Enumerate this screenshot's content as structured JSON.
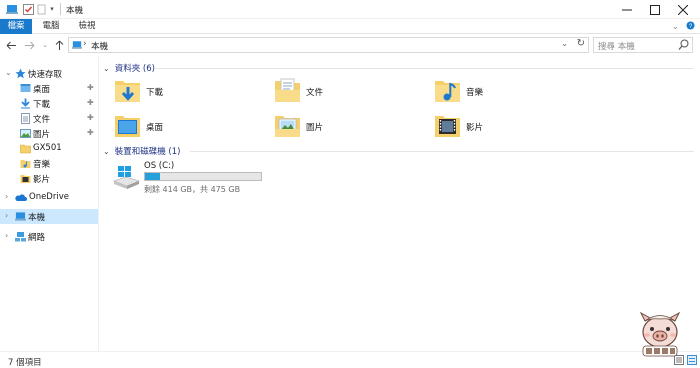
{
  "window": {
    "title": "本機",
    "controls": [
      "minimize-icon",
      "maximize-icon",
      "close-icon"
    ]
  },
  "ribbon": {
    "tabs": [
      {
        "label": "檔案"
      },
      {
        "label": "電腦"
      },
      {
        "label": "檢視"
      }
    ]
  },
  "address": {
    "path": "本機",
    "search_placeholder": "搜尋 本機"
  },
  "nav_pane": {
    "quick_access": "快速存取",
    "items": [
      {
        "label": "桌面",
        "pinned": true
      },
      {
        "label": "下載",
        "pinned": true
      },
      {
        "label": "文件",
        "pinned": true
      },
      {
        "label": "圖片",
        "pinned": true
      },
      {
        "label": "GX501",
        "pinned": false
      },
      {
        "label": "音樂",
        "pinned": false
      },
      {
        "label": "影片",
        "pinned": false
      }
    ],
    "onedrive": "OneDrive",
    "this_pc": "本機",
    "network": "網路"
  },
  "content": {
    "folders_header": "資料夾 (6)",
    "folders": [
      {
        "name": "下載",
        "icon": "downloads-folder-icon"
      },
      {
        "name": "文件",
        "icon": "documents-folder-icon"
      },
      {
        "name": "音樂",
        "icon": "music-folder-icon"
      },
      {
        "name": "桌面",
        "icon": "desktop-folder-icon"
      },
      {
        "name": "圖片",
        "icon": "pictures-folder-icon"
      },
      {
        "name": "影片",
        "icon": "videos-folder-icon"
      }
    ],
    "drives_header": "裝置和磁碟機 (1)",
    "drive": {
      "name": "OS (C:)",
      "free_text": "剩餘 414 GB，共 475 GB",
      "used_fraction": 0.128
    }
  },
  "status": {
    "item_count": "7 個項目"
  },
  "colors": {
    "accent": "#1979ca",
    "selection": "#cce8ff",
    "folder_yellow": "#f5cf6a",
    "drive_fill": "#26a0da"
  }
}
